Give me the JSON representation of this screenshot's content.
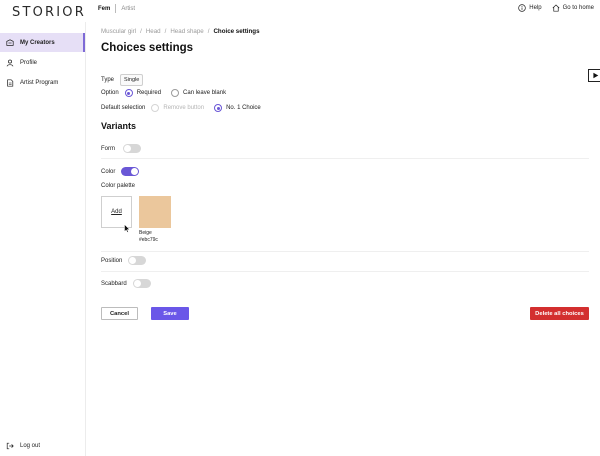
{
  "app": {
    "logo": "STORIOR"
  },
  "topbar": {
    "tabs": [
      {
        "label": "Fem"
      },
      {
        "label": "Artist"
      }
    ],
    "help": "Help",
    "go_home": "Go to home"
  },
  "sidebar": {
    "items": [
      {
        "label": "My Creators",
        "icon": "creators-icon"
      },
      {
        "label": "Profile",
        "icon": "user-icon"
      },
      {
        "label": "Artist Program",
        "icon": "document-icon"
      }
    ],
    "logout": "Log out"
  },
  "breadcrumb": [
    "Muscular girl",
    "/",
    "Head",
    "/",
    "Head shape",
    "/",
    "Choice settings"
  ],
  "page": {
    "title": "Choices settings"
  },
  "settings": {
    "type_label": "Type",
    "type_value": "Single",
    "option_label": "Option",
    "option_required": "Required",
    "option_blank": "Can leave blank",
    "default_label": "Default selection",
    "default_remove": "Remove button",
    "default_choice": "No. 1 Choice"
  },
  "variants": {
    "title": "Variants",
    "form": "Form",
    "color": "Color",
    "palette_label": "Color palette",
    "add_label": "Add",
    "swatch_name": "Beige",
    "swatch_hex": "#ebc79c",
    "position": "Position",
    "scabbard": "Scabbard"
  },
  "actions": {
    "cancel": "Cancel",
    "save": "Save",
    "delete_all": "Delete all choices"
  },
  "colors": {
    "accent": "#6a57e8",
    "danger": "#d32f2f",
    "active_nav": "#e6dff6",
    "swatch": "#ebc79c"
  }
}
